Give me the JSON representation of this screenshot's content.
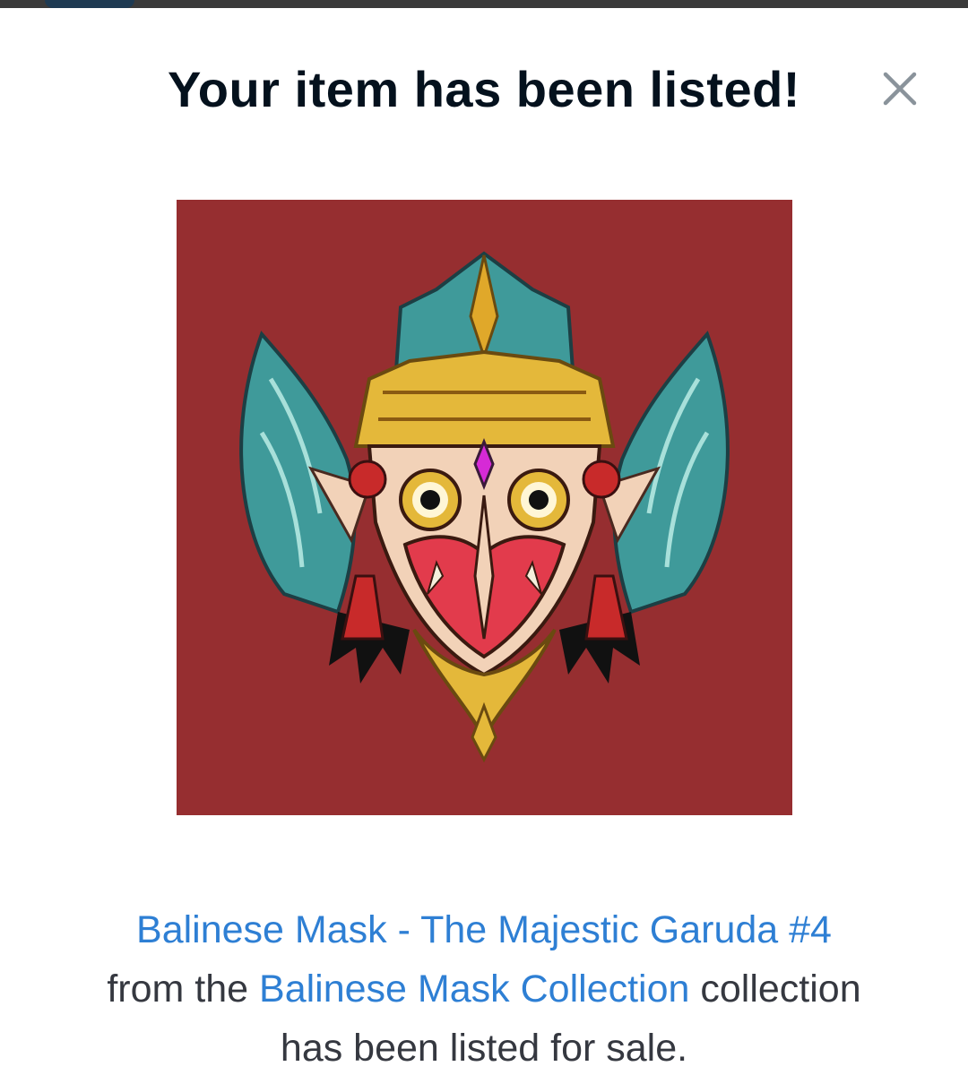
{
  "modal": {
    "title": "Your item has been listed!",
    "close_icon": "close-icon"
  },
  "item": {
    "image_icon": "balinese-garuda-mask-artwork",
    "name": "Balinese Mask - The Majestic Garuda #4",
    "text_from": "from the",
    "collection_name": "Balinese Mask Collection",
    "text_collection_suffix": "collection",
    "text_status": "has been listed for sale."
  },
  "colors": {
    "title": "#04111d",
    "link": "#2e7fd4",
    "body_text": "#353840",
    "artwork_background": "#962e30"
  }
}
